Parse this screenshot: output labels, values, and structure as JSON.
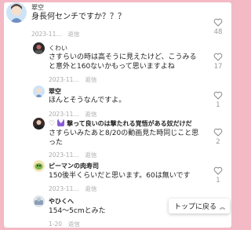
{
  "comments": [
    {
      "user": "翠空",
      "text": "身長何センチですか？？？",
      "date": "2023-11...",
      "reply": "返信",
      "likes": "48"
    },
    {
      "user": "くわい",
      "text1": "さすらいの時は高そうに見えたけど、こうみると意外と160ないかもって思いますよね",
      "line1": "さすらいの時は高そうに見えたけど、こうみる",
      "line2": "と意外と160ないかもって思いますよね",
      "date": "2023-11...",
      "reply": "返信",
      "likes": "17"
    },
    {
      "user": "翠空",
      "text": "ほんとそうなんですよ。",
      "date": "2023-11...",
      "reply": "返信",
      "likes": "1"
    },
    {
      "user_prefix_icon": "heart-outline-icon",
      "user_badge_icon": "purple-heart-badge-icon",
      "user": "撃って良いのは撃たれる覚悟がある奴だけだ",
      "line1": "さすらいみたあと8/20の動画見た時同じこと思",
      "line2": "った",
      "date": "2023-11...",
      "reply": "返信",
      "likes": "2"
    },
    {
      "user": "ピーマンの肉寿司",
      "text": "150後半くらいだと思います。60は無いです",
      "date": "2023-11...",
      "reply": "返信",
      "likes": "1"
    },
    {
      "user": "やひくへ",
      "text": "154〜5cmとみた",
      "date": "1-20",
      "reply": "返信",
      "likes": ""
    }
  ],
  "back_to_top": {
    "label": "トップに戻る",
    "icon": "double-chevron-up-icon"
  },
  "colors": {
    "background": "#f3b9c4",
    "panel": "#ffffff",
    "heart_outline": "#8a8a8a",
    "meta_text": "#aaaaaa"
  }
}
